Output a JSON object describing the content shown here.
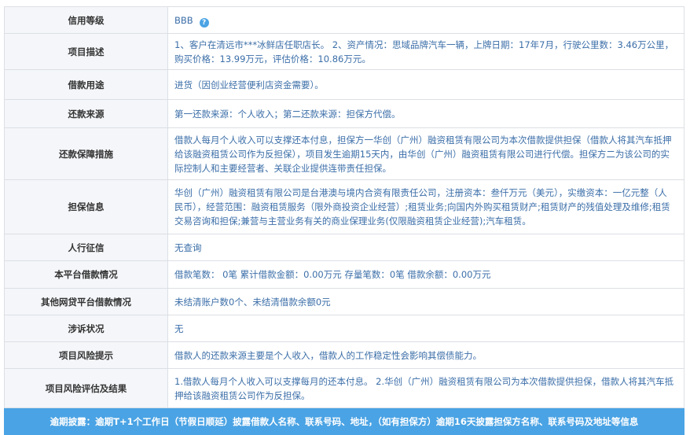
{
  "rows": [
    {
      "label": "信用等级",
      "value": "BBB"
    },
    {
      "label": "项目描述",
      "value": "1、客户在清远市***冰鲜店任职店长。 2、资产情况：思域品牌汽车一辆，上牌日期：17年7月，行驶公里数：3.46万公里，购买价格：13.99万元，评估价格：10.86万元。"
    },
    {
      "label": "借款用途",
      "value": "进货（因创业经营便利店资金需要）。"
    },
    {
      "label": "还款来源",
      "value": "第一还款来源：个人收入；第二还款来源：担保方代偿。"
    },
    {
      "label": "还款保障措施",
      "value": "借款人每月个人收入可以支撑还本付息，担保方一华创（广州）融资租赁有限公司为本次借款提供担保（借款人将其汽车抵押给该融资租赁公司作为反担保），项目发生逾期15天内，由华创（广州）融资租赁有限公司进行代偿。担保方二为该公司的实际控制人和主要经营者、关联企业提供连带责任担保。"
    },
    {
      "label": "担保信息",
      "value": "华创（广州）融资租赁有限公司是台港澳与境内合资有限责任公司，注册资本：叁仟万元（美元），实缴资本：一亿元整（人民币），经营范围：融资租赁服务（限外商投资企业经营）;租赁业务;向国内外购买租赁财产;租赁财产的残值处理及维修;租赁交易咨询和担保;兼营与主营业务有关的商业保理业务(仅限融资租赁企业经营);汽车租赁。"
    },
    {
      "label": "人行征信",
      "value": "无查询"
    },
    {
      "label": "本平台借款情况",
      "value": "借款笔数： 0笔 累计借款金额：0.00万元 存量笔数：0笔 借款余额：0.00万元"
    },
    {
      "label": "其他网贷平台借款情况",
      "value": "未结清账户数0个、未结清借款余额0元"
    },
    {
      "label": "涉诉状况",
      "value": "无"
    },
    {
      "label": "项目风险提示",
      "value": "借款人的还款来源主要是个人收入，借款人的工作稳定性会影响其偿债能力。"
    },
    {
      "label": "项目风险评估及结果",
      "value": "1.借款人每月个人收入可以支撑每月的还本付息。 2.华创（广州）融资租赁有限公司为本次借款提供担保，借款人将其汽车抵押给该融资租赁公司作为反担保。"
    }
  ],
  "help_icon": "?",
  "footer": "逾期披露：逾期T+1个工作日（节假日顺延）披露借款人名称、联系号码、地址，（如有担保方）逾期16天披露担保方名称、联系号码及地址等信息",
  "colors": {
    "accent": "#4aa3e4",
    "value_text": "#3b6ea8",
    "label_bg": "#f4f6f9"
  }
}
